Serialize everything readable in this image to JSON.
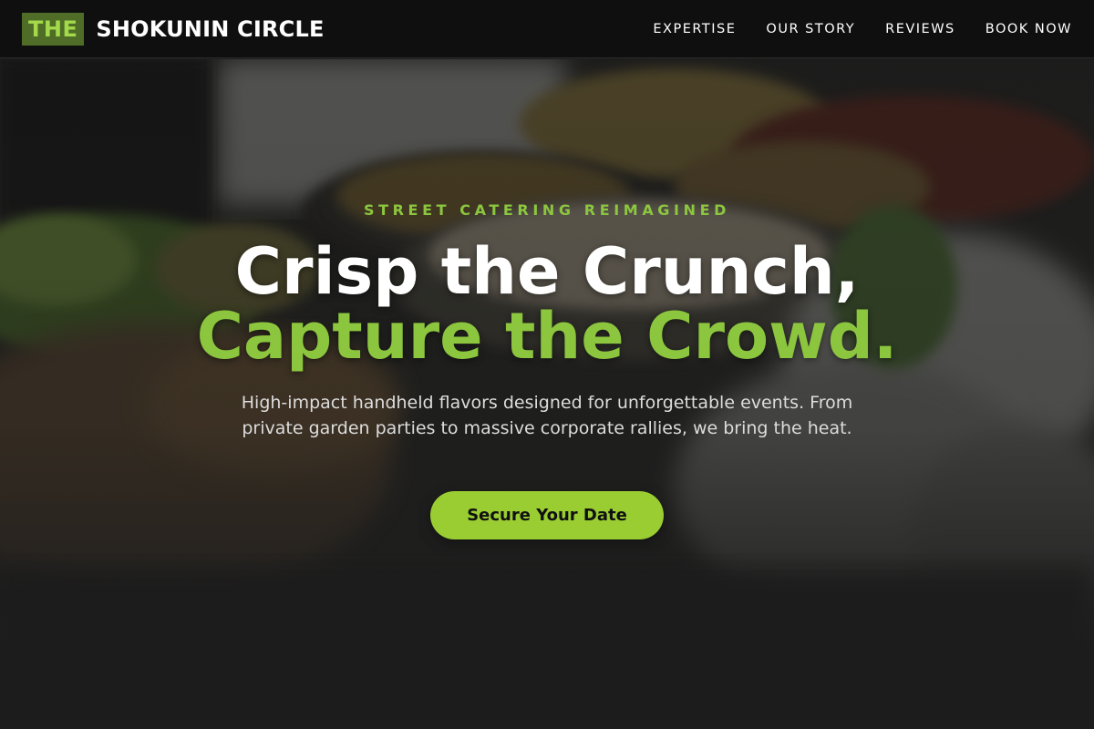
{
  "brand": {
    "badge": "THE",
    "name": "SHOKUNIN CIRCLE"
  },
  "nav": {
    "items": [
      {
        "label": "EXPERTISE"
      },
      {
        "label": "OUR STORY"
      },
      {
        "label": "REVIEWS"
      },
      {
        "label": "BOOK NOW"
      }
    ]
  },
  "hero": {
    "eyebrow": "STREET CATERING REIMAGINED",
    "headline_line1": "Crisp the Crunch,",
    "headline_line2": "Capture the Crowd.",
    "lede": "High-impact handheld flavors designed for unforgettable events. From private garden parties to massive corporate rallies, we bring the heat.",
    "cta_label": "Secure Your Date",
    "background_image": "catering-buffet-photo"
  },
  "colors": {
    "accent": "#8cc63f",
    "button": "#9acd32",
    "header_bg": "#0f0f0f",
    "logo_badge_bg": "#4f6d27"
  }
}
